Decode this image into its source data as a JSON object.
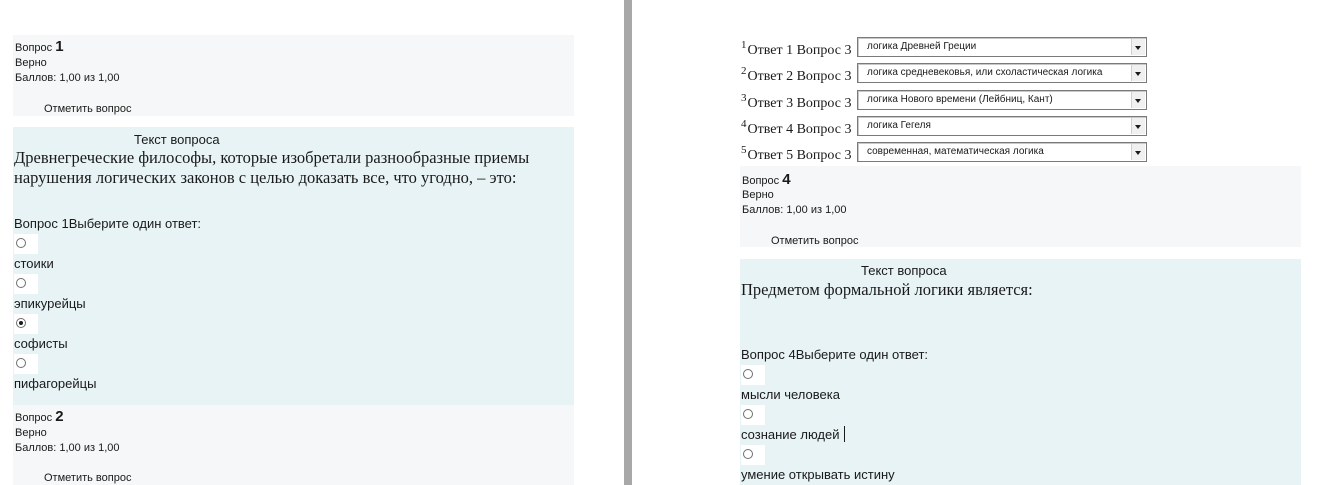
{
  "colors": {
    "info_bg": "#f5f7f8",
    "content_bg": "#e7f3f5",
    "gutter": "#a8a8a8"
  },
  "left": {
    "q1": {
      "question_prefix": "Вопрос",
      "number": "1",
      "status": "Верно",
      "score": "Баллов: 1,00 из 1,00",
      "flag_label": "Отметить вопрос",
      "text_label": "Текст вопроса",
      "text_line1": "Древнегреческие философы, которые изобретали разнообразные приемы",
      "text_line2": "нарушения логических законов с целью доказать все, что угодно, – это:",
      "prompt": "Вопрос 1Выберите один ответ:",
      "options": [
        {
          "label": "стоики",
          "checked": false
        },
        {
          "label": "эпикурейцы",
          "checked": false
        },
        {
          "label": "софисты",
          "checked": true
        },
        {
          "label": "пифагорейцы",
          "checked": false
        }
      ]
    },
    "q2": {
      "question_prefix": "Вопрос",
      "number": "2",
      "status": "Верно",
      "score": "Баллов: 1,00 из 1,00",
      "flag_label": "Отметить вопрос"
    }
  },
  "right": {
    "matches": [
      {
        "index": "1",
        "label": "Ответ 1 Вопрос 3",
        "value": "логика Древней Греции"
      },
      {
        "index": "2",
        "label": "Ответ 2 Вопрос 3",
        "value": "логика средневековья, или схоластическая логика"
      },
      {
        "index": "3",
        "label": "Ответ 3 Вопрос 3",
        "value": "логика Нового времени (Лейбниц, Кант)"
      },
      {
        "index": "4",
        "label": "Ответ 4 Вопрос 3",
        "value": "логика Гегеля"
      },
      {
        "index": "5",
        "label": "Ответ 5 Вопрос 3",
        "value": "современная, математическая логика"
      }
    ],
    "q4": {
      "question_prefix": "Вопрос",
      "number": "4",
      "status": "Верно",
      "score": "Баллов: 1,00 из 1,00",
      "flag_label": "Отметить вопрос",
      "text_label": "Текст вопроса",
      "text_line1": "Предметом формальной логики является:",
      "prompt": "Вопрос 4Выберите один ответ:",
      "options": [
        {
          "label": "мысли человека",
          "checked": false
        },
        {
          "label": "сознание людей",
          "checked": false
        },
        {
          "label": "умение открывать истину",
          "checked": false
        }
      ]
    }
  }
}
